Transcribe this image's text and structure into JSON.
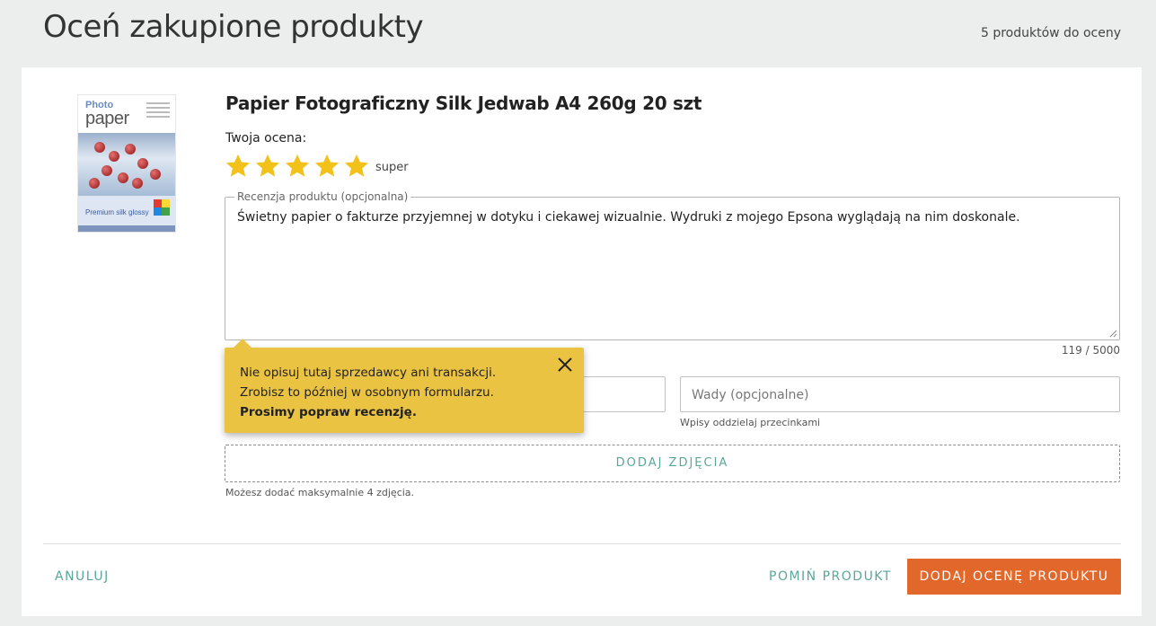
{
  "header": {
    "title": "Oceń zakupione produkty",
    "count": "5 produktów do oceny"
  },
  "product": {
    "name": "Papier Fotograficzny Silk Jedwab A4 260g 20 szt",
    "image": {
      "brand_line1": "Photo",
      "brand_line2": "paper",
      "subtitle": "Premium silk glossy",
      "logo": "ColorWay"
    }
  },
  "rating": {
    "label": "Twoja ocena:",
    "stars": 5,
    "max": 5,
    "text": "super",
    "star_color": "#f2c21b"
  },
  "review": {
    "legend": "Recenzja produktu (opcjonalna)",
    "value": "Świetny papier o fakturze przyjemnej w dotyku i ciekawej wizualnie. Wydruki z mojego Epsona wyglądają na nim doskonale.",
    "char_count": "119 / 5000"
  },
  "cons": {
    "placeholder": "Wady (opcjonalne)",
    "hint": "Wpisy oddzielaj przecinkami"
  },
  "photos": {
    "button": "DODAJ ZDJĘCIA",
    "hint": "Możesz dodać maksymalnie 4 zdjęcia."
  },
  "tooltip": {
    "line1": "Nie opisuj tutaj sprzedawcy ani transakcji.",
    "line2": "Zrobisz to później w osobnym formularzu.",
    "line3": "Prosimy popraw recenzję.",
    "bg_color": "#ebc342"
  },
  "actions": {
    "cancel": "ANULUJ",
    "skip": "POMIŃ PRODUKT",
    "submit": "DODAJ OCENĘ PRODUKTU",
    "accent_color": "#5aa69a",
    "submit_color": "#e2672a"
  }
}
